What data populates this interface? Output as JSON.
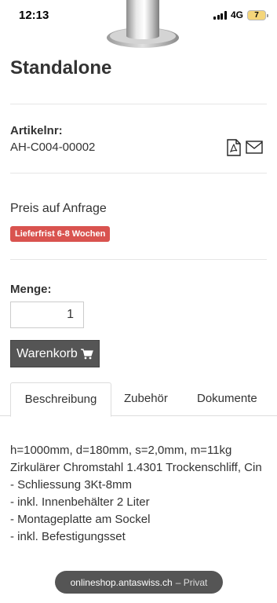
{
  "status": {
    "time": "12:13",
    "network": "4G",
    "battery": "7"
  },
  "product": {
    "title": "Standalone",
    "article_label": "Artikelnr:",
    "article_number": "AH-C004-00002",
    "price": "Preis auf Anfrage",
    "delivery_badge": "Lieferfrist 6-8 Wochen",
    "badge_color": "#d9534f"
  },
  "order": {
    "quantity_label": "Menge:",
    "quantity_value": "1",
    "cart_button": "Warenkorb"
  },
  "tabs": [
    {
      "label": "Beschreibung",
      "active": true
    },
    {
      "label": "Zubehör",
      "active": false
    },
    {
      "label": "Dokumente",
      "active": false
    }
  ],
  "description": [
    "h=1000mm, d=180mm, s=2,0mm, m=11kg",
    "Zirkulärer Chromstahl 1.4301 Trockenschliff, Cin",
    "- Schliessung 3Kt-8mm",
    "- inkl. Innenbehälter 2 Liter",
    "- Montageplatte am Sockel",
    "- inkl. Befestigungsset"
  ],
  "browser": {
    "url": "onlineshop.antaswiss.ch",
    "mode": "– Privat"
  },
  "icons": {
    "pdf": "pdf-icon",
    "mail": "mail-icon",
    "cart": "cart-icon"
  }
}
